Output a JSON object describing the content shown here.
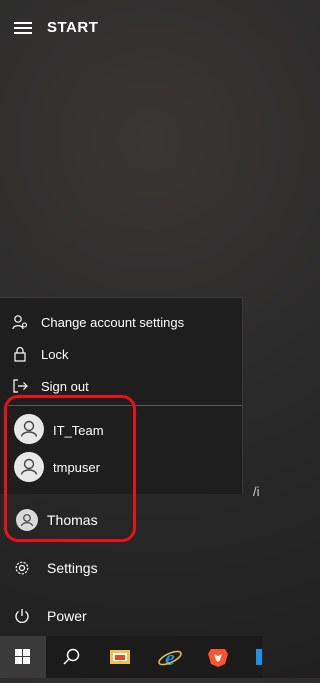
{
  "header": {
    "title": "START"
  },
  "account_menu": {
    "items": [
      {
        "label": "Change account settings",
        "icon": "account-settings-icon"
      },
      {
        "label": "Lock",
        "icon": "lock-icon"
      },
      {
        "label": "Sign out",
        "icon": "sign-out-icon"
      }
    ],
    "other_users": [
      {
        "name": "IT_Team",
        "icon": "user-icon"
      },
      {
        "name": "tmpuser",
        "icon": "user-icon"
      }
    ]
  },
  "current_user": {
    "name": "Thomas",
    "icon": "user-icon"
  },
  "nav": {
    "settings_label": "Settings",
    "power_label": "Power"
  },
  "edge_text": "/i",
  "taskbar": {
    "items": [
      "windows-start-icon",
      "search-icon",
      "file-explorer-icon",
      "internet-explorer-icon",
      "brave-browser-icon",
      "app-icon"
    ]
  },
  "colors": {
    "highlight": "#e8111b",
    "taskbar": "#1b1b1b",
    "flyout": "#1e1e1e",
    "ie_blue": "#1e90e6",
    "brave_orange": "#fb542b"
  }
}
